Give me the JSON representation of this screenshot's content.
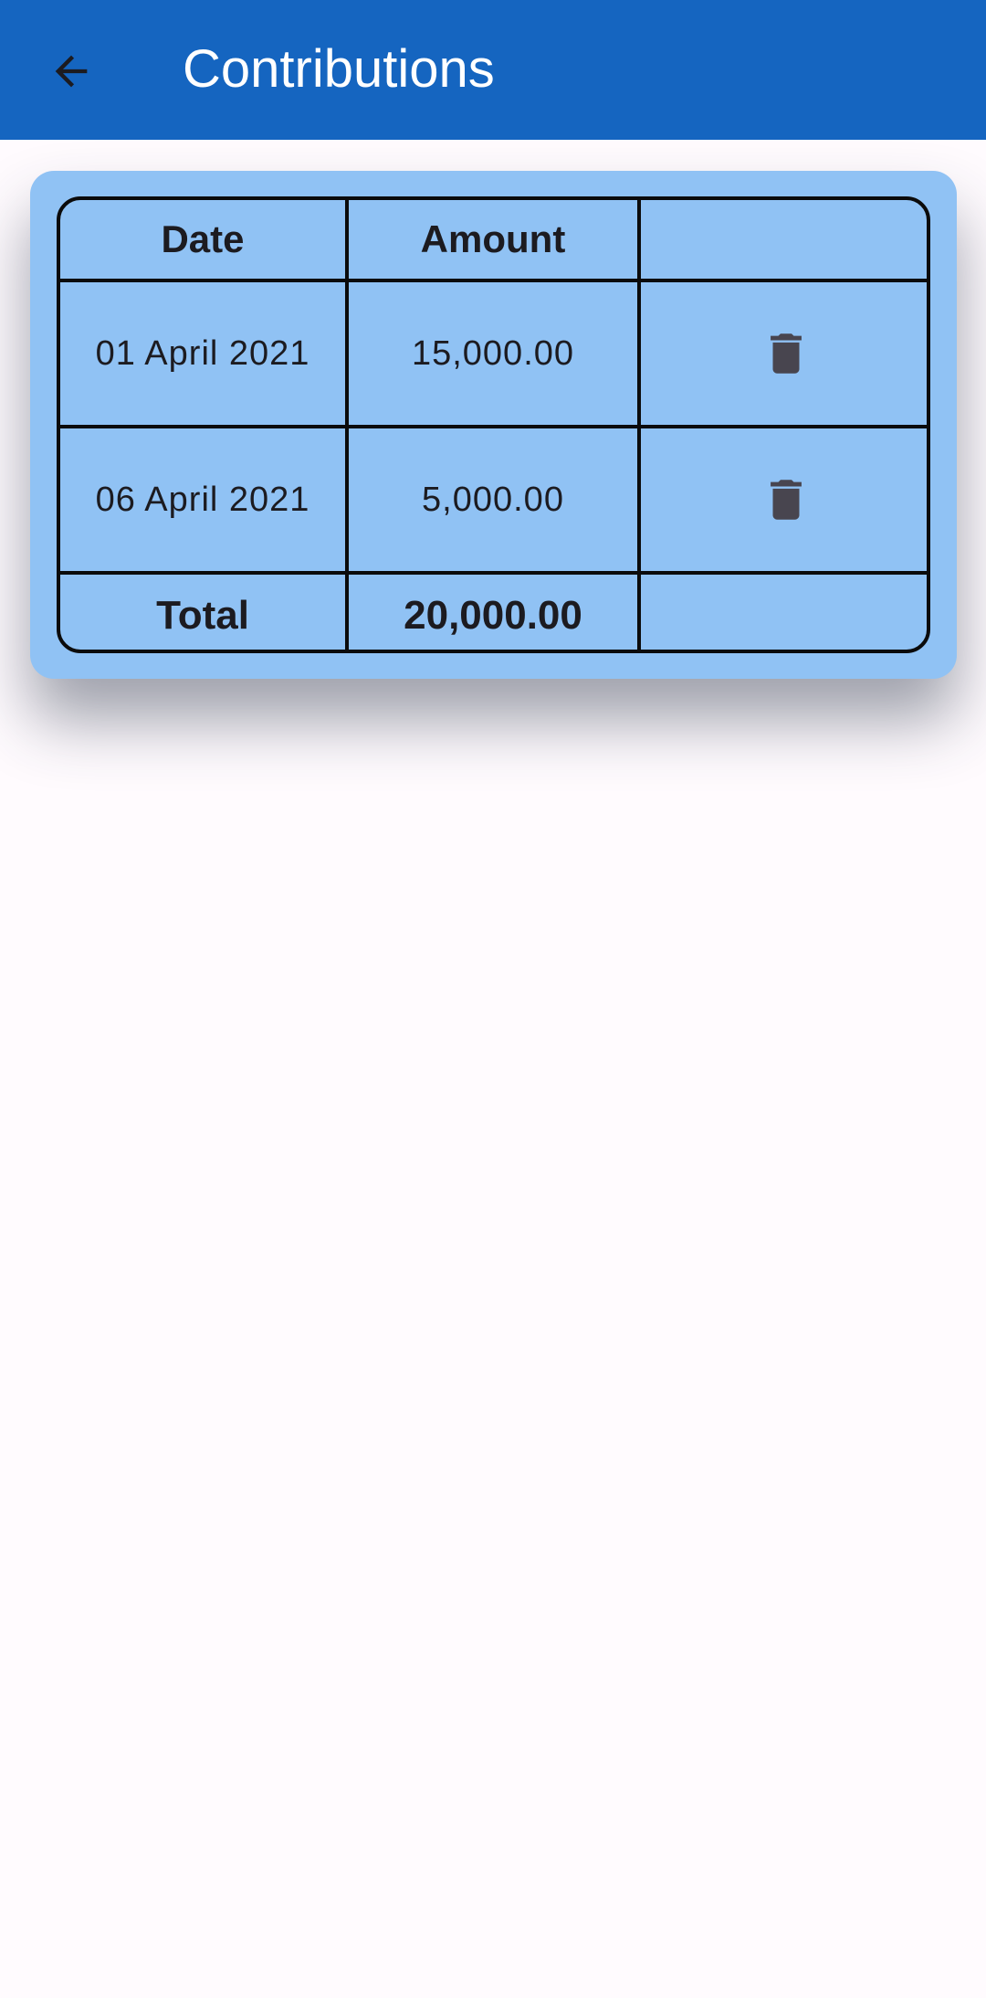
{
  "app_bar": {
    "title": "Contributions",
    "back_icon": "arrow-back-icon",
    "background_color": "#1565c0"
  },
  "card": {
    "background_color": "#90c2f4"
  },
  "table": {
    "headers": [
      "Date",
      "Amount",
      ""
    ],
    "rows": [
      {
        "date": "01 April 2021",
        "amount": "15,000.00",
        "action_icon": "trash-icon"
      },
      {
        "date": "06 April 2021",
        "amount": "5,000.00",
        "action_icon": "trash-icon"
      }
    ],
    "total": {
      "label": "Total",
      "amount": "20,000.00"
    }
  }
}
